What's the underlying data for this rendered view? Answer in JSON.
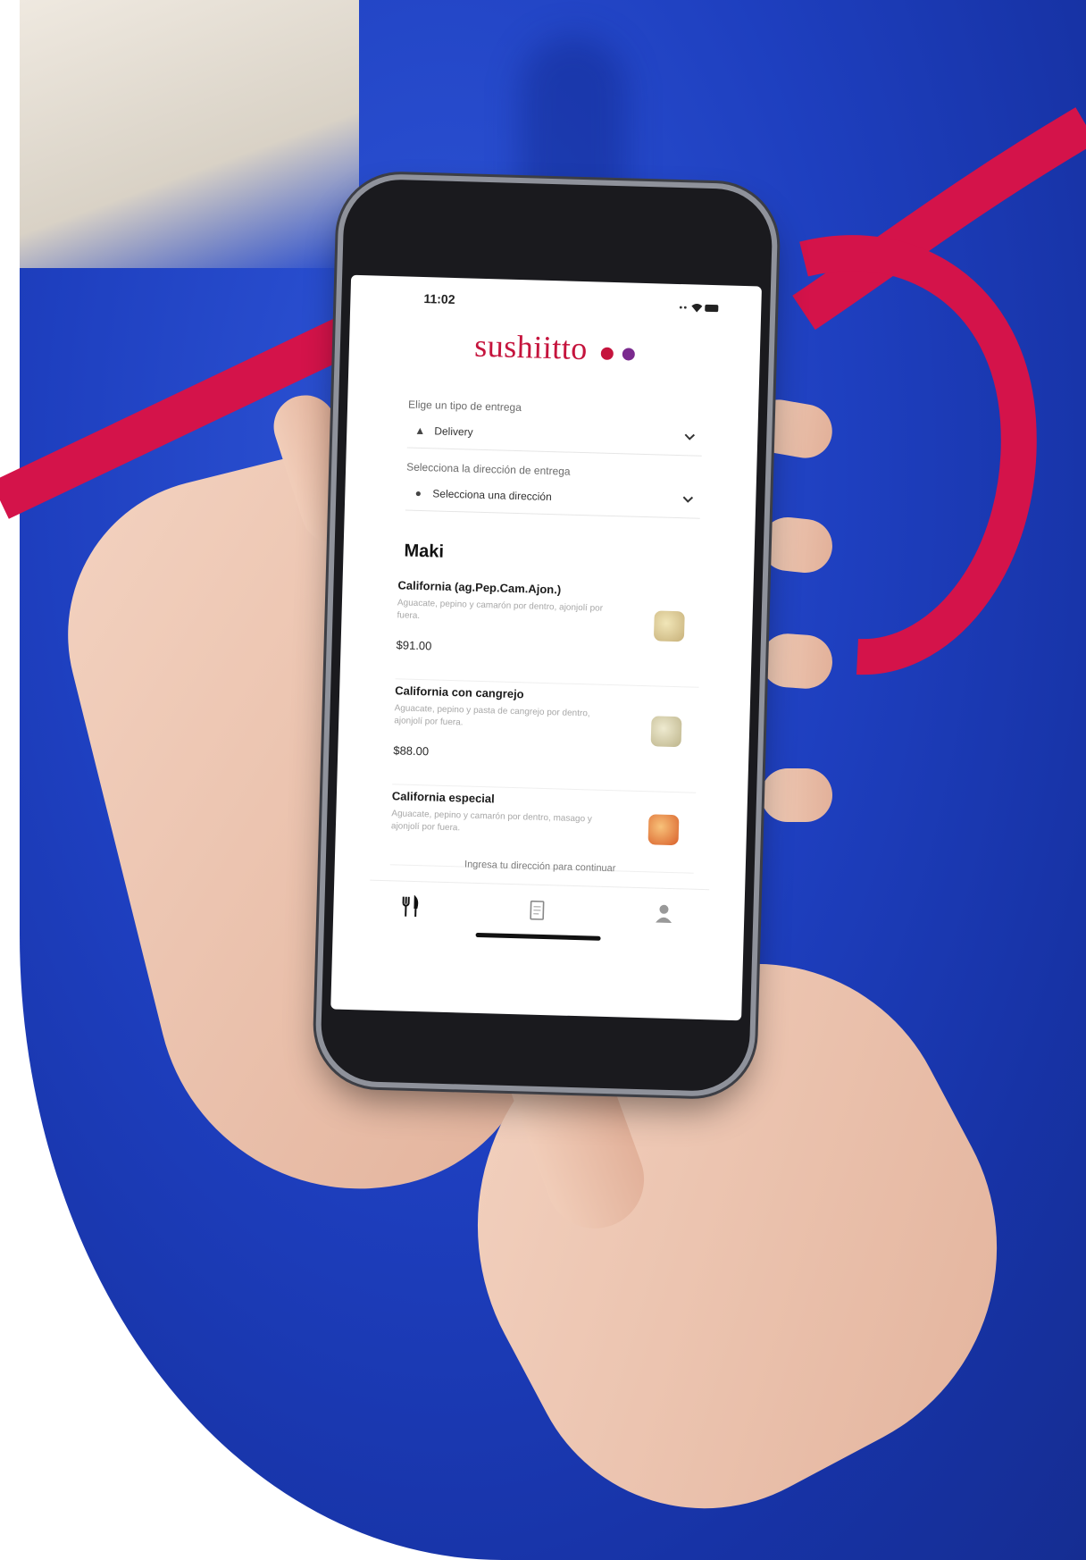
{
  "status": {
    "time": "11:02"
  },
  "brand": {
    "name": "sushiitto",
    "colors": [
      "#c5143d",
      "#7a2a8e"
    ]
  },
  "delivery": {
    "type_label": "Elige un tipo de entrega",
    "type_value": "Delivery",
    "type_icon": "scooter-icon",
    "address_label": "Selecciona la dirección de entrega",
    "address_value": "Selecciona una dirección",
    "address_icon": "location-pin-icon"
  },
  "menu": {
    "section": "Maki",
    "items": [
      {
        "title": "California (ag.Pep.Cam.Ajon.)",
        "desc": "Aguacate, pepino y camarón por dentro, ajonjolí por fuera.",
        "price": "$91.00",
        "thumb_color": "#d9c48c"
      },
      {
        "title": "California con cangrejo",
        "desc": "Aguacate, pepino y pasta de cangrejo por dentro, ajonjolí por fuera.",
        "price": "$88.00",
        "thumb_color": "#cfc9a2"
      },
      {
        "title": "California especial",
        "desc": "Aguacate, pepino y camarón por dentro, masago y ajonjolí por fuera.",
        "price": "",
        "thumb_color": "#e07a3a"
      }
    ]
  },
  "cta": "Ingresa tu dirección para continuar",
  "tabs": [
    {
      "name": "menu",
      "icon": "fork-knife-icon"
    },
    {
      "name": "orders",
      "icon": "receipt-icon"
    },
    {
      "name": "profile",
      "icon": "user-icon"
    }
  ],
  "accent": "#d4134a"
}
